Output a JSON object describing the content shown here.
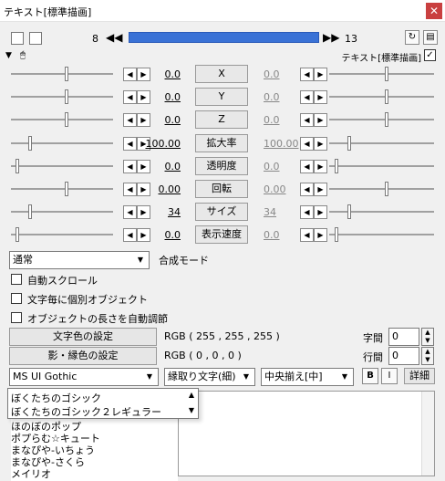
{
  "window": {
    "title": "テキスト[標準描画]",
    "close_icon": "close-icon"
  },
  "frame_nav": {
    "start_frame": "8",
    "end_frame": "13",
    "prev_label": "◀◀",
    "next_label": "▶▶",
    "track_color": "#3a72d6",
    "position_pct": 100
  },
  "header": {
    "object_name": "テキスト[標準描画]"
  },
  "params": [
    {
      "name": "X",
      "value": "0.0",
      "value_right": "0.0",
      "left_pos": 0.55,
      "right_pos": 0.55
    },
    {
      "name": "Y",
      "value": "0.0",
      "value_right": "0.0",
      "left_pos": 0.55,
      "right_pos": 0.55
    },
    {
      "name": "Z",
      "value": "0.0",
      "value_right": "0.0",
      "left_pos": 0.55,
      "right_pos": 0.55
    },
    {
      "name": "拡大率",
      "value": "100.00",
      "value_right": "100.00",
      "left_pos": 0.18,
      "right_pos": 0.18
    },
    {
      "name": "透明度",
      "value": "0.0",
      "value_right": "0.0",
      "left_pos": 0.05,
      "right_pos": 0.05
    },
    {
      "name": "回転",
      "value": "0.00",
      "value_right": "0.00",
      "left_pos": 0.55,
      "right_pos": 0.55
    },
    {
      "name": "サイズ",
      "value": "34",
      "value_right": "34",
      "left_pos": 0.18,
      "right_pos": 0.18
    },
    {
      "name": "表示速度",
      "value": "0.0",
      "value_right": "0.0",
      "left_pos": 0.05,
      "right_pos": 0.05
    }
  ],
  "blend": {
    "value": "通常",
    "label": "合成モード"
  },
  "checkboxes": [
    {
      "label": "自動スクロール"
    },
    {
      "label": "文字毎に個別オブジェクト"
    },
    {
      "label": "オブジェクトの長さを自動調節"
    }
  ],
  "colors": {
    "text_color_button": "文字色の設定",
    "text_color_value": "RGB ( 255 , 255 , 255 )",
    "shadow_color_button": "影・縁色の設定",
    "shadow_color_value": "RGB ( 0 , 0 , 0 )"
  },
  "spacing": {
    "char_label": "字間",
    "char_value": "0",
    "line_label": "行間",
    "line_value": "0"
  },
  "font": {
    "selected": "MS UI Gothic",
    "style": "縁取り文字(細)",
    "align": "中央揃え[中]",
    "bold": "B",
    "italic": "I",
    "detail": "詳細"
  },
  "font_list_highlighted": [
    "ぼくたちのゴシック",
    "ぼくたちのゴシック２レギュラー"
  ],
  "font_list_more": [
    "ほのぼのポップ",
    "ポプらむ☆キュート",
    "まなぴや-いちょう",
    "まなぴや-さくら",
    "メイリオ"
  ]
}
